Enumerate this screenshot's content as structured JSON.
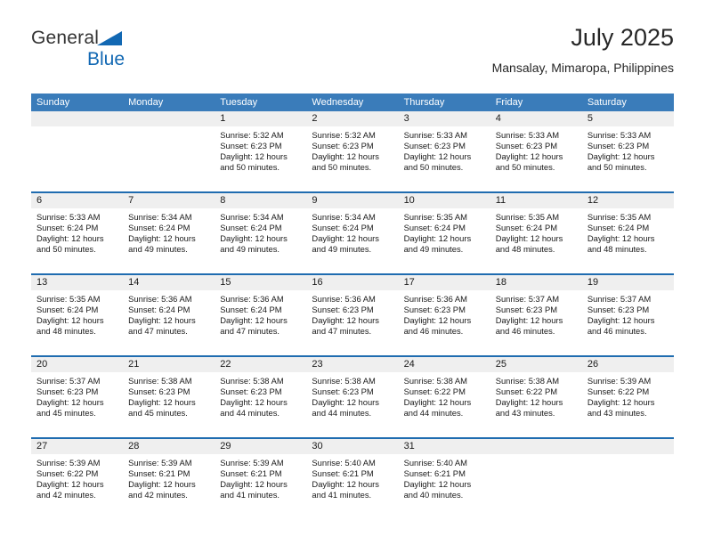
{
  "logo": {
    "word1": "General",
    "word2": "Blue",
    "triangle_color": "#1268b3"
  },
  "header": {
    "title": "July 2025",
    "location": "Mansalay, Mimaropa, Philippines"
  },
  "theme": {
    "header_blue": "#3a7cba",
    "row_divider_blue": "#1f6cb0",
    "day_band_gray": "#efefef"
  },
  "weekdays": [
    "Sunday",
    "Monday",
    "Tuesday",
    "Wednesday",
    "Thursday",
    "Friday",
    "Saturday"
  ],
  "weeks": [
    [
      {
        "day": "",
        "lines": []
      },
      {
        "day": "",
        "lines": []
      },
      {
        "day": "1",
        "lines": [
          "Sunrise: 5:32 AM",
          "Sunset: 6:23 PM",
          "Daylight: 12 hours",
          "and 50 minutes."
        ]
      },
      {
        "day": "2",
        "lines": [
          "Sunrise: 5:32 AM",
          "Sunset: 6:23 PM",
          "Daylight: 12 hours",
          "and 50 minutes."
        ]
      },
      {
        "day": "3",
        "lines": [
          "Sunrise: 5:33 AM",
          "Sunset: 6:23 PM",
          "Daylight: 12 hours",
          "and 50 minutes."
        ]
      },
      {
        "day": "4",
        "lines": [
          "Sunrise: 5:33 AM",
          "Sunset: 6:23 PM",
          "Daylight: 12 hours",
          "and 50 minutes."
        ]
      },
      {
        "day": "5",
        "lines": [
          "Sunrise: 5:33 AM",
          "Sunset: 6:23 PM",
          "Daylight: 12 hours",
          "and 50 minutes."
        ]
      }
    ],
    [
      {
        "day": "6",
        "lines": [
          "Sunrise: 5:33 AM",
          "Sunset: 6:24 PM",
          "Daylight: 12 hours",
          "and 50 minutes."
        ]
      },
      {
        "day": "7",
        "lines": [
          "Sunrise: 5:34 AM",
          "Sunset: 6:24 PM",
          "Daylight: 12 hours",
          "and 49 minutes."
        ]
      },
      {
        "day": "8",
        "lines": [
          "Sunrise: 5:34 AM",
          "Sunset: 6:24 PM",
          "Daylight: 12 hours",
          "and 49 minutes."
        ]
      },
      {
        "day": "9",
        "lines": [
          "Sunrise: 5:34 AM",
          "Sunset: 6:24 PM",
          "Daylight: 12 hours",
          "and 49 minutes."
        ]
      },
      {
        "day": "10",
        "lines": [
          "Sunrise: 5:35 AM",
          "Sunset: 6:24 PM",
          "Daylight: 12 hours",
          "and 49 minutes."
        ]
      },
      {
        "day": "11",
        "lines": [
          "Sunrise: 5:35 AM",
          "Sunset: 6:24 PM",
          "Daylight: 12 hours",
          "and 48 minutes."
        ]
      },
      {
        "day": "12",
        "lines": [
          "Sunrise: 5:35 AM",
          "Sunset: 6:24 PM",
          "Daylight: 12 hours",
          "and 48 minutes."
        ]
      }
    ],
    [
      {
        "day": "13",
        "lines": [
          "Sunrise: 5:35 AM",
          "Sunset: 6:24 PM",
          "Daylight: 12 hours",
          "and 48 minutes."
        ]
      },
      {
        "day": "14",
        "lines": [
          "Sunrise: 5:36 AM",
          "Sunset: 6:24 PM",
          "Daylight: 12 hours",
          "and 47 minutes."
        ]
      },
      {
        "day": "15",
        "lines": [
          "Sunrise: 5:36 AM",
          "Sunset: 6:24 PM",
          "Daylight: 12 hours",
          "and 47 minutes."
        ]
      },
      {
        "day": "16",
        "lines": [
          "Sunrise: 5:36 AM",
          "Sunset: 6:23 PM",
          "Daylight: 12 hours",
          "and 47 minutes."
        ]
      },
      {
        "day": "17",
        "lines": [
          "Sunrise: 5:36 AM",
          "Sunset: 6:23 PM",
          "Daylight: 12 hours",
          "and 46 minutes."
        ]
      },
      {
        "day": "18",
        "lines": [
          "Sunrise: 5:37 AM",
          "Sunset: 6:23 PM",
          "Daylight: 12 hours",
          "and 46 minutes."
        ]
      },
      {
        "day": "19",
        "lines": [
          "Sunrise: 5:37 AM",
          "Sunset: 6:23 PM",
          "Daylight: 12 hours",
          "and 46 minutes."
        ]
      }
    ],
    [
      {
        "day": "20",
        "lines": [
          "Sunrise: 5:37 AM",
          "Sunset: 6:23 PM",
          "Daylight: 12 hours",
          "and 45 minutes."
        ]
      },
      {
        "day": "21",
        "lines": [
          "Sunrise: 5:38 AM",
          "Sunset: 6:23 PM",
          "Daylight: 12 hours",
          "and 45 minutes."
        ]
      },
      {
        "day": "22",
        "lines": [
          "Sunrise: 5:38 AM",
          "Sunset: 6:23 PM",
          "Daylight: 12 hours",
          "and 44 minutes."
        ]
      },
      {
        "day": "23",
        "lines": [
          "Sunrise: 5:38 AM",
          "Sunset: 6:23 PM",
          "Daylight: 12 hours",
          "and 44 minutes."
        ]
      },
      {
        "day": "24",
        "lines": [
          "Sunrise: 5:38 AM",
          "Sunset: 6:22 PM",
          "Daylight: 12 hours",
          "and 44 minutes."
        ]
      },
      {
        "day": "25",
        "lines": [
          "Sunrise: 5:38 AM",
          "Sunset: 6:22 PM",
          "Daylight: 12 hours",
          "and 43 minutes."
        ]
      },
      {
        "day": "26",
        "lines": [
          "Sunrise: 5:39 AM",
          "Sunset: 6:22 PM",
          "Daylight: 12 hours",
          "and 43 minutes."
        ]
      }
    ],
    [
      {
        "day": "27",
        "lines": [
          "Sunrise: 5:39 AM",
          "Sunset: 6:22 PM",
          "Daylight: 12 hours",
          "and 42 minutes."
        ]
      },
      {
        "day": "28",
        "lines": [
          "Sunrise: 5:39 AM",
          "Sunset: 6:21 PM",
          "Daylight: 12 hours",
          "and 42 minutes."
        ]
      },
      {
        "day": "29",
        "lines": [
          "Sunrise: 5:39 AM",
          "Sunset: 6:21 PM",
          "Daylight: 12 hours",
          "and 41 minutes."
        ]
      },
      {
        "day": "30",
        "lines": [
          "Sunrise: 5:40 AM",
          "Sunset: 6:21 PM",
          "Daylight: 12 hours",
          "and 41 minutes."
        ]
      },
      {
        "day": "31",
        "lines": [
          "Sunrise: 5:40 AM",
          "Sunset: 6:21 PM",
          "Daylight: 12 hours",
          "and 40 minutes."
        ]
      },
      {
        "day": "",
        "lines": []
      },
      {
        "day": "",
        "lines": []
      }
    ]
  ]
}
